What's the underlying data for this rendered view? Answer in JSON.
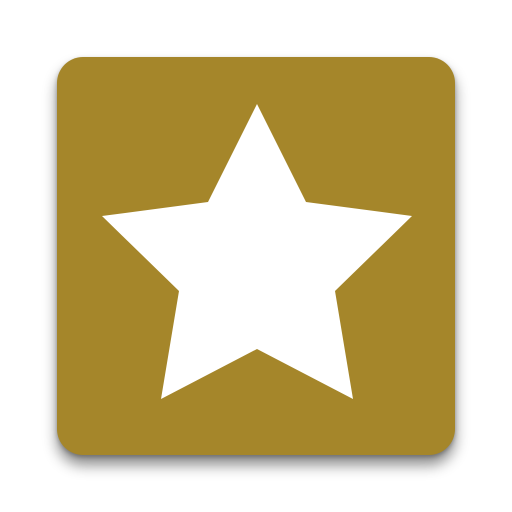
{
  "icon": {
    "name": "star-icon",
    "background_color": "#A5862A",
    "glyph_color": "#FFFFFF"
  }
}
